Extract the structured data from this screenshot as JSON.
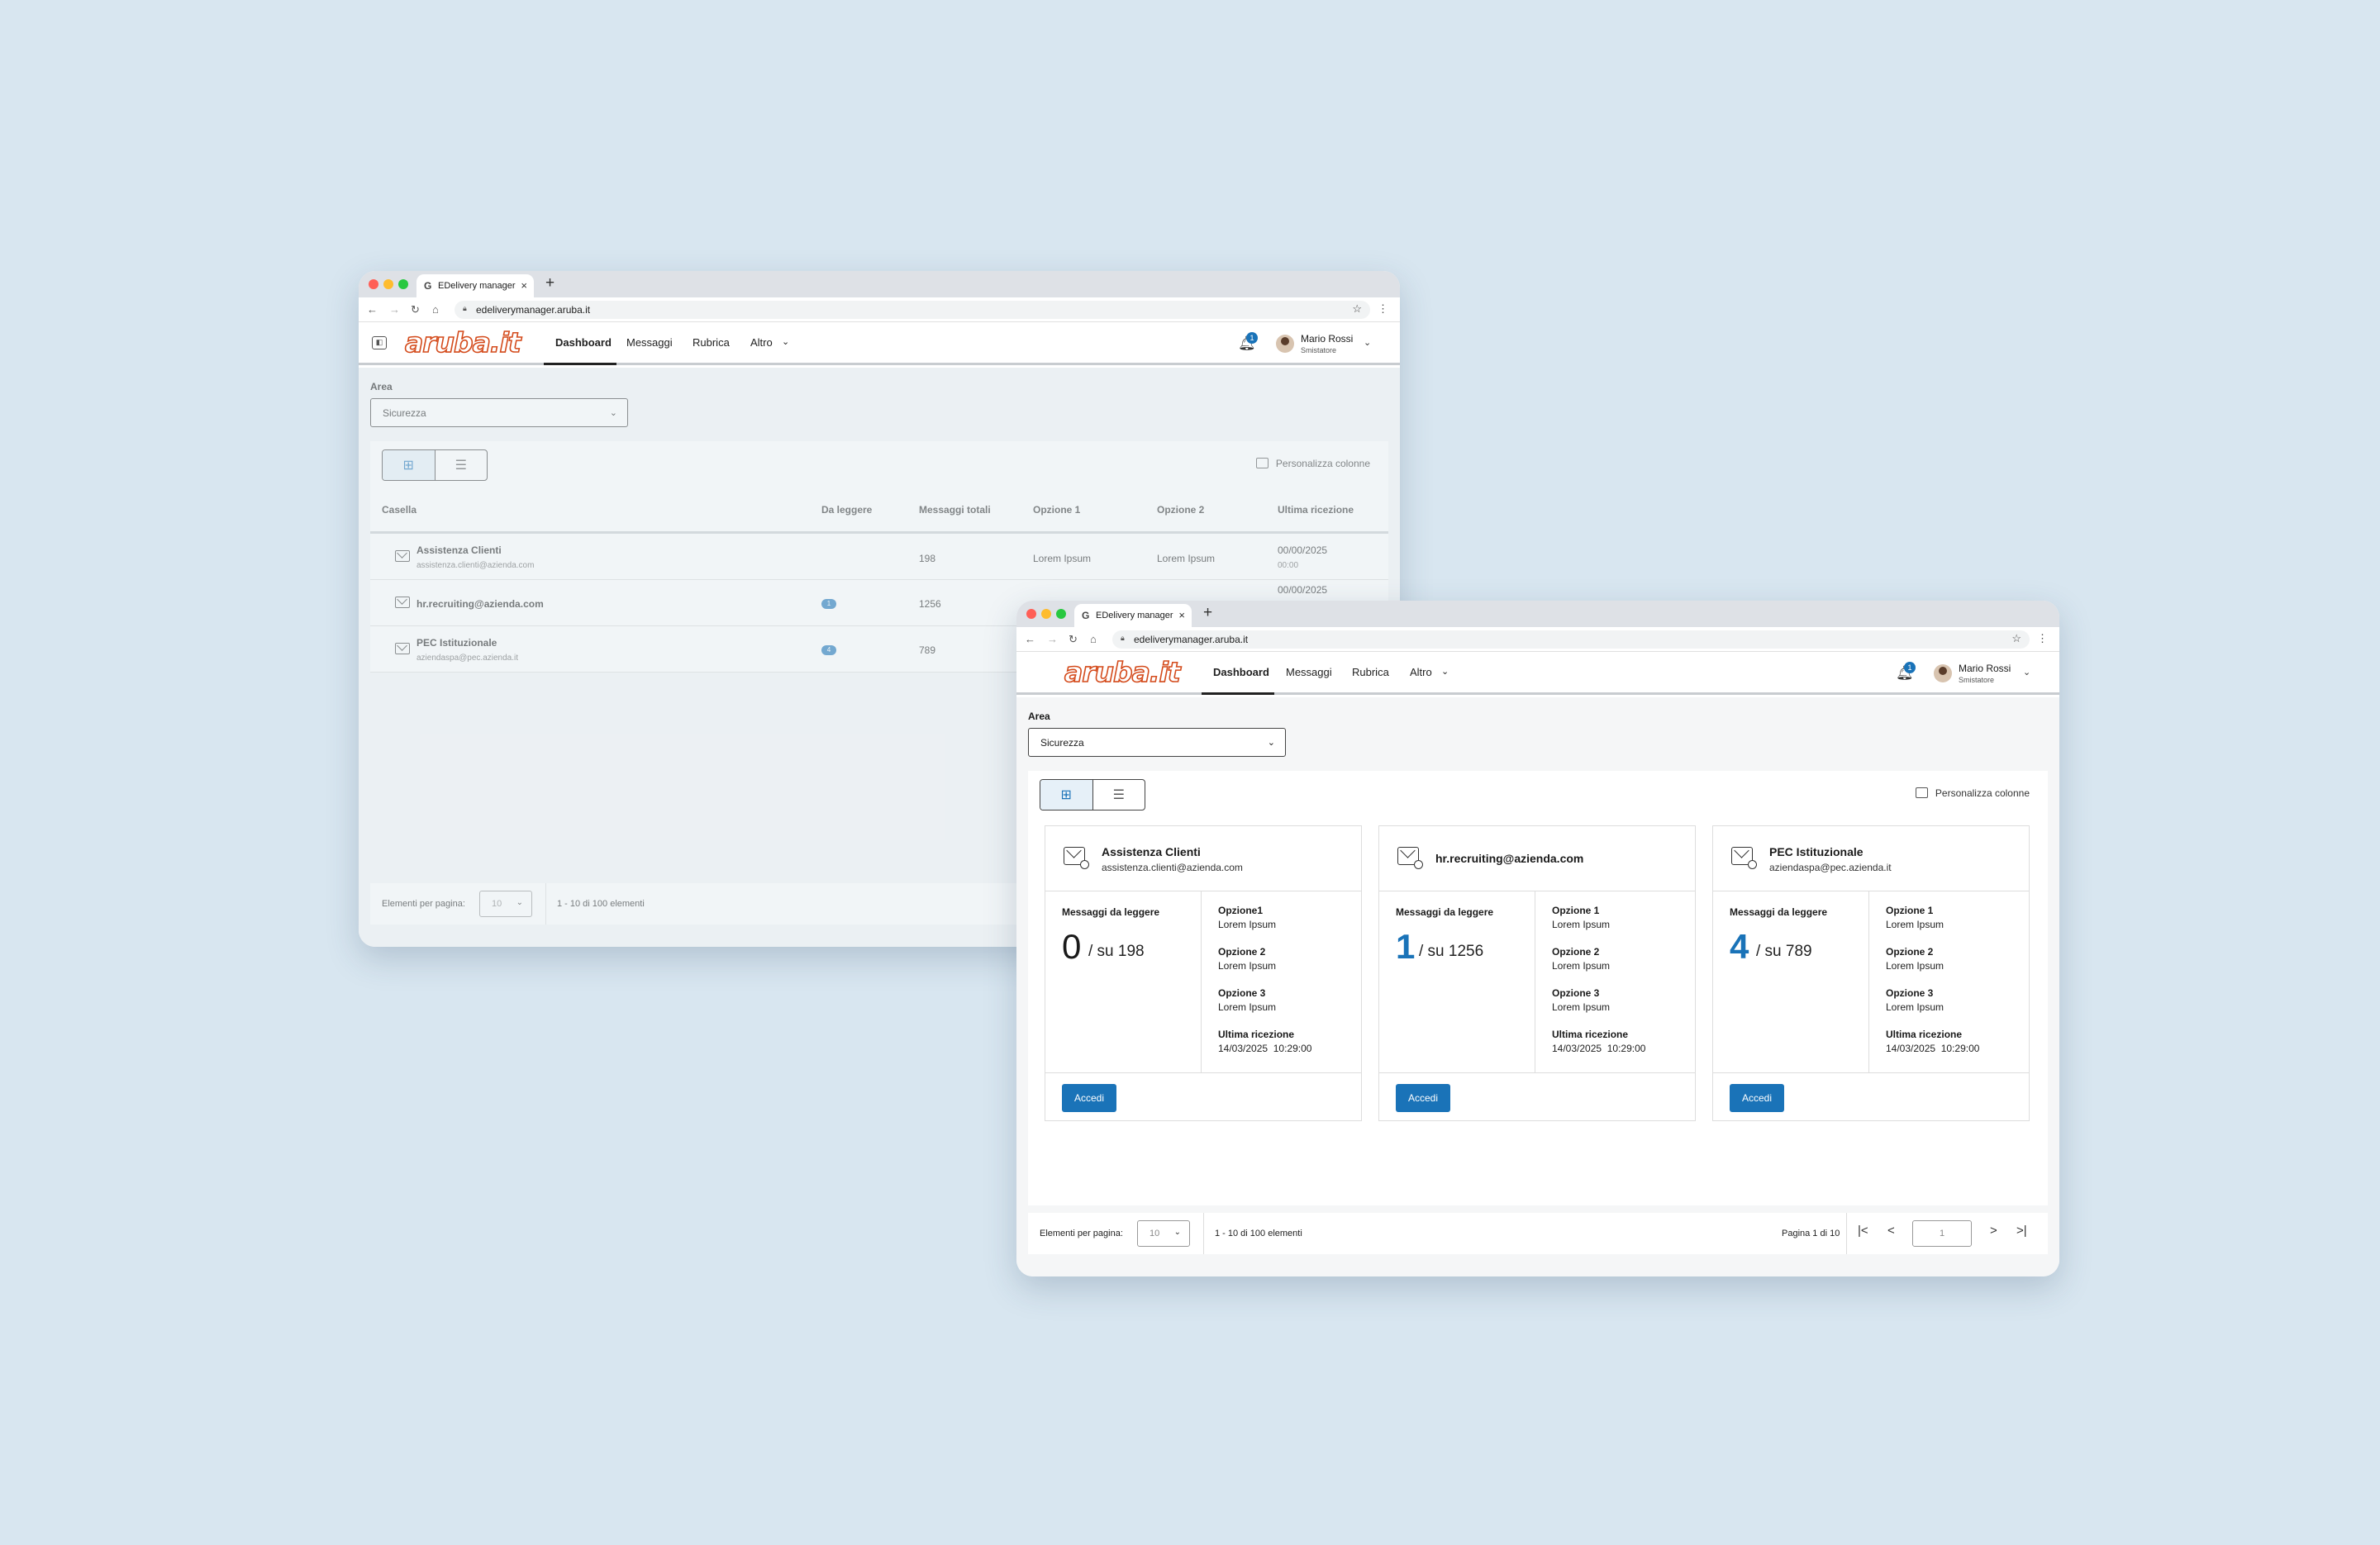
{
  "browser": {
    "tab_favicon": "G",
    "tab_title": "EDelivery manager",
    "tab_close": "×",
    "new_tab": "+",
    "url": "edeliverymanager.aruba.it"
  },
  "app": {
    "logo": "aruba.it",
    "nav": [
      {
        "label": "Dashboard"
      },
      {
        "label": "Messaggi"
      },
      {
        "label": "Rubrica"
      },
      {
        "label": "Altro"
      }
    ],
    "notification_count": "1",
    "user_name": "Mario Rossi",
    "user_role": "Smistatore"
  },
  "filters": {
    "area_label": "Area",
    "area_value": "Sicurezza",
    "personalizza": "Personalizza colonne"
  },
  "table": {
    "headers": [
      "Casella",
      "Da leggere",
      "Messaggi totali",
      "Opzione 1",
      "Opzione 2",
      "Ultima ricezione"
    ],
    "rows": [
      {
        "name": "Assistenza Clienti",
        "email": "assistenza.clienti@azienda.com",
        "unread": "",
        "total": "198",
        "opt1": "Lorem Ipsum",
        "opt2": "Lorem Ipsum",
        "date": "00/00/2025",
        "time": "00:00"
      },
      {
        "name": "hr.recruiting@azienda.com",
        "email": "",
        "unread": "1",
        "total": "1256",
        "opt1": "",
        "opt2": "",
        "date": "00/00/2025",
        "time": ""
      },
      {
        "name": "PEC Istituzionale",
        "email": "aziendaspa@pec.azienda.it",
        "unread": "4",
        "total": "789",
        "opt1": "",
        "opt2": "",
        "date": "",
        "time": ""
      }
    ]
  },
  "pagination": {
    "per_page_label": "Elementi per pagina:",
    "per_page_value": "10",
    "range": "1 - 10 di 100 elementi",
    "page_label": "Pagina 1 di 10",
    "page_input": "1"
  },
  "cards": [
    {
      "title": "Assistenza Clienti",
      "email": "assistenza.clienti@azienda.com",
      "unread_label": "Messaggi da leggere",
      "unread": "0",
      "total": "/ su 198",
      "opt1_label": "Opzione1",
      "opt1": "Lorem Ipsum",
      "opt2_label": "Opzione 2",
      "opt2": "Lorem Ipsum",
      "opt3_label": "Opzione 3",
      "opt3": "Lorem Ipsum",
      "last_label": "Ultima ricezione",
      "last": "14/03/2025  10:29:00",
      "button": "Accedi"
    },
    {
      "title": "hr.recruiting@azienda.com",
      "email": "",
      "unread_label": "Messaggi da leggere",
      "unread": "1",
      "total": "/ su 1256",
      "opt1_label": "Opzione 1",
      "opt1": "Lorem Ipsum",
      "opt2_label": "Opzione 2",
      "opt2": "Lorem Ipsum",
      "opt3_label": "Opzione 3",
      "opt3": "Lorem Ipsum",
      "last_label": "Ultima ricezione",
      "last": "14/03/2025  10:29:00",
      "button": "Accedi"
    },
    {
      "title": "PEC Istituzionale",
      "email": "aziendaspa@pec.azienda.it",
      "unread_label": "Messaggi da leggere",
      "unread": "4",
      "total": "/ su 789",
      "opt1_label": "Opzione 1",
      "opt1": "Lorem Ipsum",
      "opt2_label": "Opzione 2",
      "opt2": "Lorem Ipsum",
      "opt3_label": "Opzione 3",
      "opt3": "Lorem Ipsum",
      "last_label": "Ultima ricezione",
      "last": "14/03/2025  10:29:00",
      "button": "Accedi"
    }
  ],
  "icons": {
    "back": "arrow-left-icon",
    "forward": "arrow-right-icon",
    "reload": "reload-icon",
    "home": "home-icon",
    "lock": "lock-icon",
    "star": "star-icon",
    "menu": "kebab-icon",
    "bell": "bell-icon",
    "grid": "grid-view-icon",
    "list": "list-view-icon",
    "columns": "columns-icon",
    "mail": "mail-icon"
  },
  "colors": {
    "accent": "#1a73b8",
    "logo": "#d44b1c",
    "background": "#d8e6f0"
  }
}
